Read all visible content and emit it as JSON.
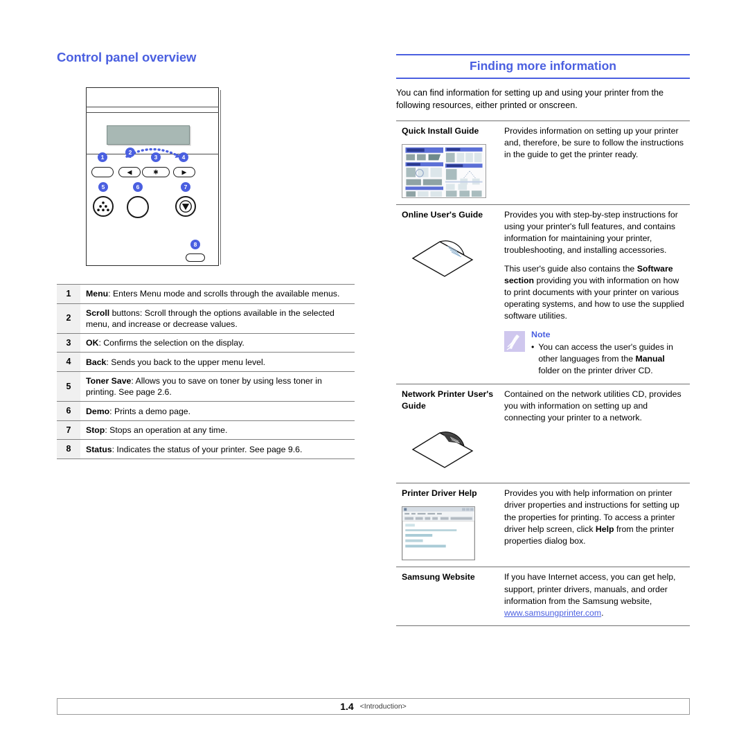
{
  "left": {
    "heading": "Control panel overview",
    "figure": {
      "callouts": [
        "1",
        "2",
        "3",
        "4",
        "5",
        "6",
        "7",
        "8"
      ],
      "button_glyphs": {
        "scroll_left": "◀",
        "ok": "✱",
        "scroll_right": "▶"
      },
      "lcd_label": "lcd-display"
    },
    "table": {
      "rows": [
        {
          "num": "1",
          "term": "Menu",
          "text": ": Enters Menu mode and scrolls through the available menus."
        },
        {
          "num": "2",
          "term": "Scroll",
          "text": " buttons: Scroll through the options available in the selected menu, and increase or decrease values."
        },
        {
          "num": "3",
          "term": "OK",
          "text": ": Confirms the selection on the display."
        },
        {
          "num": "4",
          "term": "Back",
          "text": ": Sends you back to the upper menu level."
        },
        {
          "num": "5",
          "term": "Toner Save",
          "text": ": Allows you to save on toner by using less toner in printing. See page 2.6."
        },
        {
          "num": "6",
          "term": "Demo",
          "text": ": Prints a demo page."
        },
        {
          "num": "7",
          "term": "Stop",
          "text": ": Stops an operation at any time."
        },
        {
          "num": "8",
          "term": "Status",
          "text": ": Indicates the status of your printer. See page 9.6."
        }
      ]
    }
  },
  "right": {
    "heading": "Finding more information",
    "intro": "You can find information for setting up and using your printer from the following resources, either printed or onscreen.",
    "rows": {
      "quick_install": {
        "label": "Quick Install Guide",
        "thumb_title": "Quick Install Guide",
        "desc": "Provides information on setting up your printer and, therefore, be sure to follow the instructions in the guide to get the printer ready."
      },
      "online_guide": {
        "label": "Online User's Guide",
        "desc1": "Provides you with step-by-step instructions for using your printer's full features, and contains information for maintaining your printer, troubleshooting, and installing accessories.",
        "desc2_a": "This user's guide also contains the ",
        "desc2_bold1": "Software section",
        "desc2_b": " providing you with information on how to print documents with your printer on various operating systems, and how to use the supplied software utilities.",
        "note": {
          "title": "Note",
          "bullet": "•",
          "text_a": "You can access the user's guides in other languages from the ",
          "text_bold": "Manual",
          "text_b": " folder on the printer driver CD."
        }
      },
      "network_guide": {
        "label": "Network Printer User's Guide",
        "desc": "Contained on the network utilities CD, provides you with information on setting up and connecting your printer to a network."
      },
      "driver_help": {
        "label": "Printer Driver Help",
        "desc_a": "Provides you with help information on printer driver properties and instructions for setting up the properties for printing. To access a printer driver help screen, click ",
        "desc_bold": "Help",
        "desc_b": " from the printer properties dialog box."
      },
      "samsung_website": {
        "label": "Samsung Website",
        "desc_a": "If you have Internet access, you can get help, support, printer drivers, manuals, and order information from the Samsung website, ",
        "link": "www.samsungprinter.com",
        "desc_b": "."
      }
    }
  },
  "footer": {
    "page": "1.4",
    "section": "<Introduction>"
  },
  "colors": {
    "accent_blue": "#4a5fe0",
    "rule_gray": "#707070",
    "num_cell_bg": "#f0f0f0",
    "lcd": "#a8b8b4"
  }
}
